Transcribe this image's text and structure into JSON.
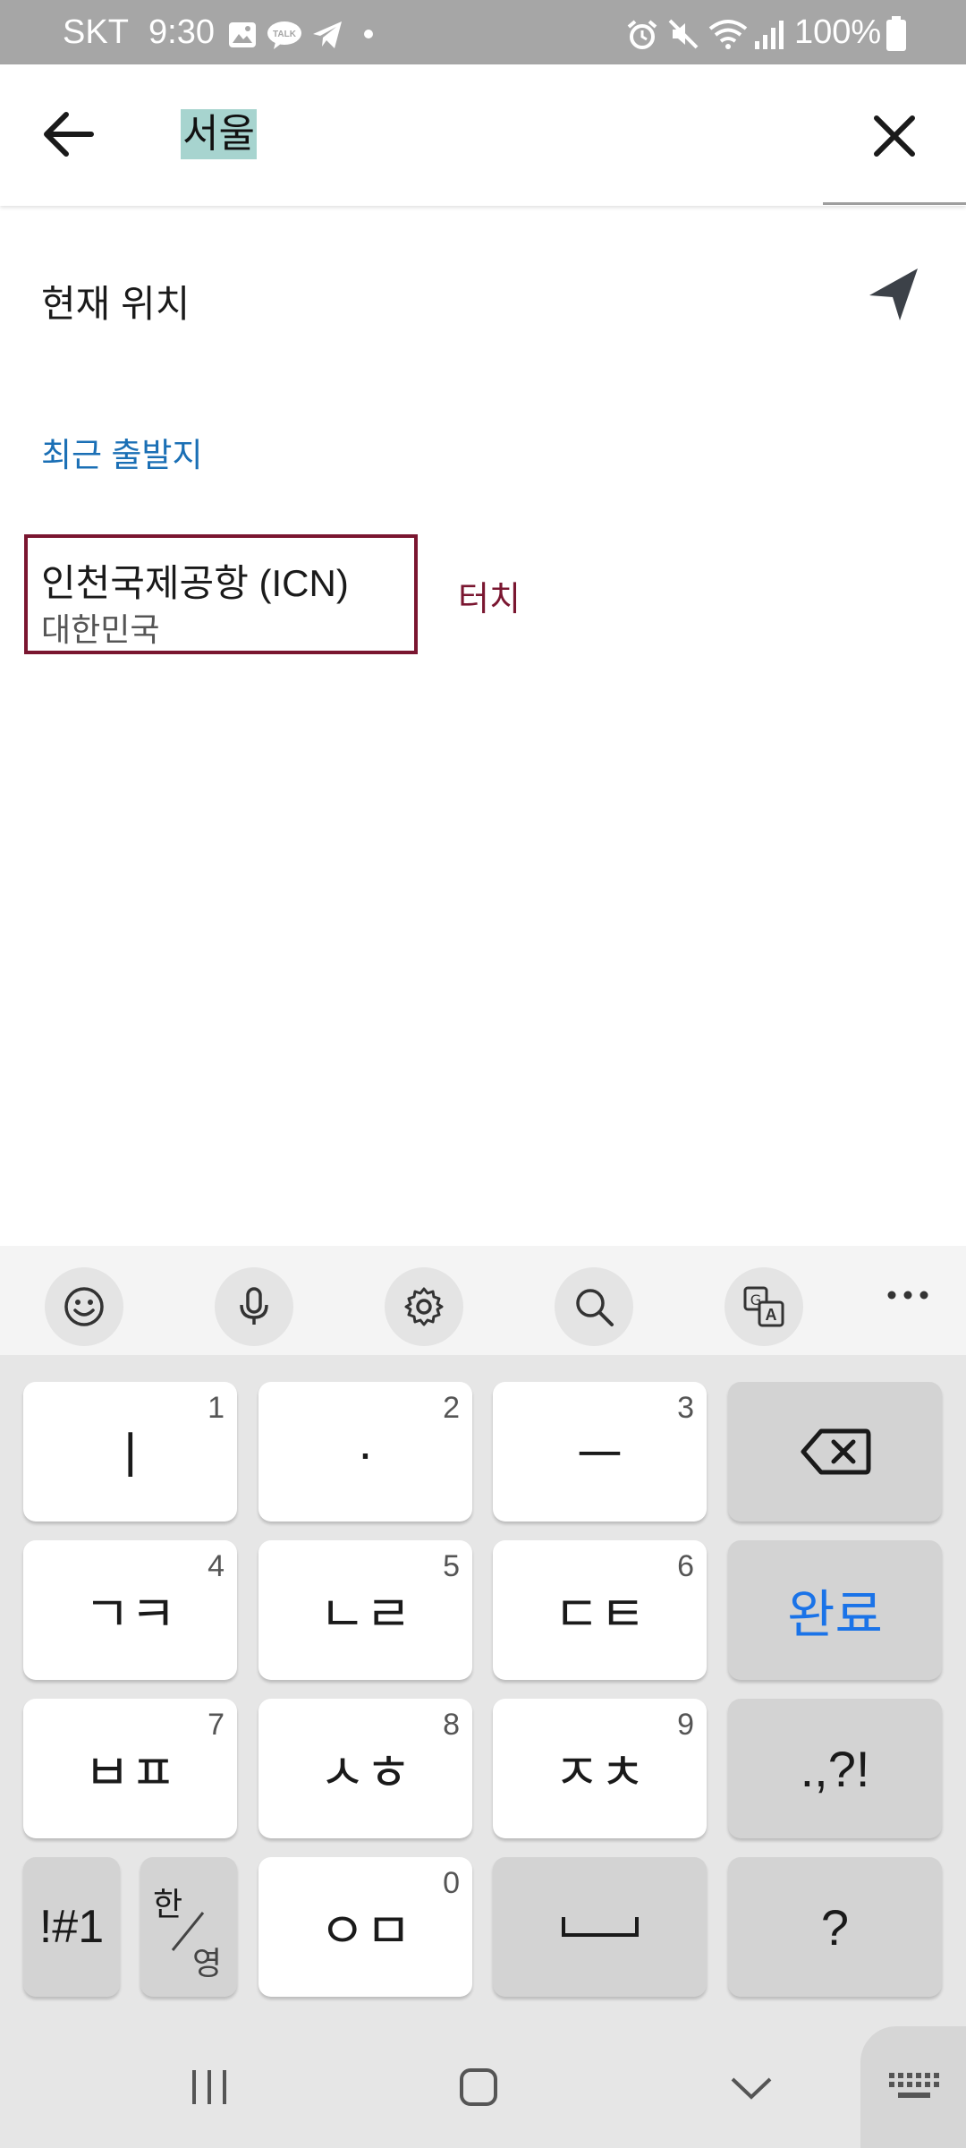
{
  "status_bar": {
    "carrier": "SKT",
    "time": "9:30",
    "battery": "100%",
    "left_icons": [
      "image-icon",
      "kakaotalk-icon",
      "telegram-icon",
      "dot-icon"
    ],
    "right_icons": [
      "alarm-icon",
      "mute-icon",
      "wifi-icon",
      "signal-icon",
      "battery-icon"
    ]
  },
  "search": {
    "query": "서울"
  },
  "current_location": {
    "label": "현재 위치"
  },
  "recent": {
    "header": "최근 출발지",
    "items": [
      {
        "name": "인천국제공항 (ICN)",
        "country": "대한민국"
      }
    ]
  },
  "annotation": {
    "touch_label": "터치"
  },
  "keyboard": {
    "toolbar_icons": [
      "emoji-icon",
      "microphone-icon",
      "settings-icon",
      "search-icon",
      "translate-icon",
      "more-icon"
    ],
    "row1": [
      {
        "label": "ㅣ",
        "num": "1"
      },
      {
        "label": "·",
        "num": "2"
      },
      {
        "label": "ㅡ",
        "num": "3"
      }
    ],
    "row2": [
      {
        "label": "ㄱㅋ",
        "num": "4"
      },
      {
        "label": "ㄴㄹ",
        "num": "5"
      },
      {
        "label": "ㄷㅌ",
        "num": "6"
      }
    ],
    "done_label": "완료",
    "row3": [
      {
        "label": "ㅂㅍ",
        "num": "7"
      },
      {
        "label": "ㅅㅎ",
        "num": "8"
      },
      {
        "label": "ㅈㅊ",
        "num": "9"
      }
    ],
    "punct_label": ".,?!",
    "symbols_label": "!#1",
    "lang_top": "한",
    "lang_bottom": "영",
    "row4_key": {
      "label": "ㅇㅁ",
      "num": "0"
    },
    "question_label": "?",
    "accent_color": "#1a73e8"
  },
  "colors": {
    "status_bar": "#a6a6a6",
    "section_blue": "#1a6fb5",
    "highlight_box": "#7a1630",
    "search_highlight": "#a7d4cf"
  }
}
